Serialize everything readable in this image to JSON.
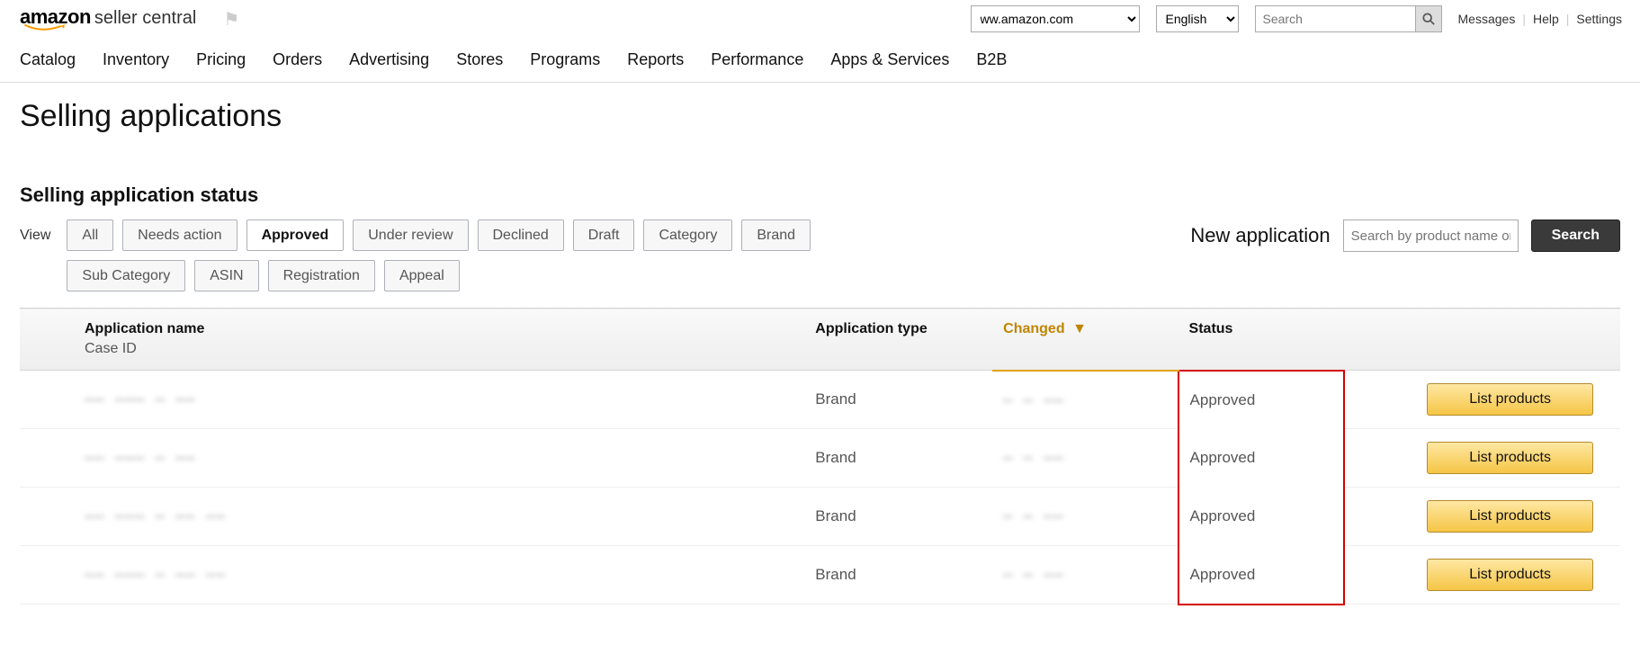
{
  "header": {
    "logo_text": "amazon",
    "logo_subtitle": "seller central",
    "marketplace_selected": "ww.amazon.com",
    "language_selected": "English",
    "search_placeholder": "Search",
    "links": {
      "messages": "Messages",
      "help": "Help",
      "settings": "Settings"
    }
  },
  "nav": [
    "Catalog",
    "Inventory",
    "Pricing",
    "Orders",
    "Advertising",
    "Stores",
    "Programs",
    "Reports",
    "Performance",
    "Apps & Services",
    "B2B"
  ],
  "page": {
    "title": "Selling applications",
    "section_title": "Selling application status",
    "view_label": "View"
  },
  "filters": {
    "buttons": [
      "All",
      "Needs action",
      "Approved",
      "Under review",
      "Declined",
      "Draft",
      "Category",
      "Brand",
      "Sub Category",
      "ASIN",
      "Registration",
      "Appeal"
    ],
    "active": "Approved"
  },
  "new_application": {
    "label": "New application",
    "search_placeholder": "Search by product name or",
    "search_button": "Search"
  },
  "table": {
    "columns": {
      "name": "Application name",
      "name_sub": "Case ID",
      "type": "Application type",
      "changed": "Changed",
      "status": "Status"
    },
    "rows": [
      {
        "name": "—— ——— — ——",
        "type": "Brand",
        "changed": "— — ——",
        "status": "Approved",
        "action": "List products"
      },
      {
        "name": "—— ——— — ——",
        "type": "Brand",
        "changed": "— — ——",
        "status": "Approved",
        "action": "List products"
      },
      {
        "name": "—— ——— — —— ——",
        "type": "Brand",
        "changed": "— — ——",
        "status": "Approved",
        "action": "List products"
      },
      {
        "name": "—— ——— — —— ——",
        "type": "Brand",
        "changed": "— — ——",
        "status": "Approved",
        "action": "List products"
      }
    ]
  }
}
